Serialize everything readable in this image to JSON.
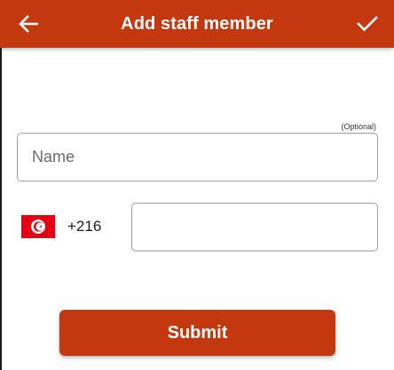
{
  "header": {
    "title": "Add staff member",
    "back_icon": "arrow-left-icon",
    "confirm_icon": "check-icon",
    "background_color": "#c4380f"
  },
  "form": {
    "name_optional_note": "(Optional)",
    "name_placeholder": "Name",
    "name_value": "",
    "country": {
      "flag_icon": "tunisia-flag-icon",
      "dial_code": "+216"
    },
    "phone_value": ""
  },
  "submit": {
    "label": "Submit",
    "color": "#c4380f"
  }
}
